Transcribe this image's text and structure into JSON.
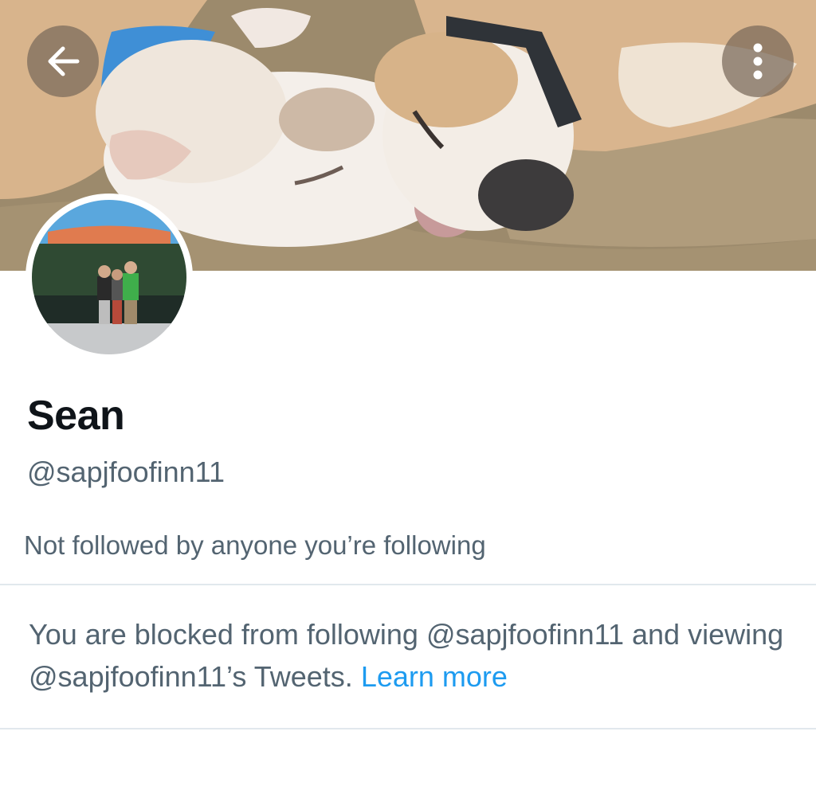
{
  "header": {
    "back_icon": "arrow-left-icon",
    "more_icon": "vertical-ellipsis-icon"
  },
  "banner": {
    "description_icon": "banner-photo"
  },
  "profile": {
    "name": "Sean",
    "handle": "@sapjfoofinn11",
    "followers_note": "Not followed by anyone you’re following"
  },
  "blocked": {
    "message": "You are blocked from following @sapjfoofinn11 and viewing @sapjfoofinn11’s Tweets.",
    "learn_more": "Learn more"
  },
  "colors": {
    "accent": "#1d9bf0",
    "secondary_text": "#536471",
    "primary_text": "#0f1419",
    "divider": "#e1e8ed"
  }
}
